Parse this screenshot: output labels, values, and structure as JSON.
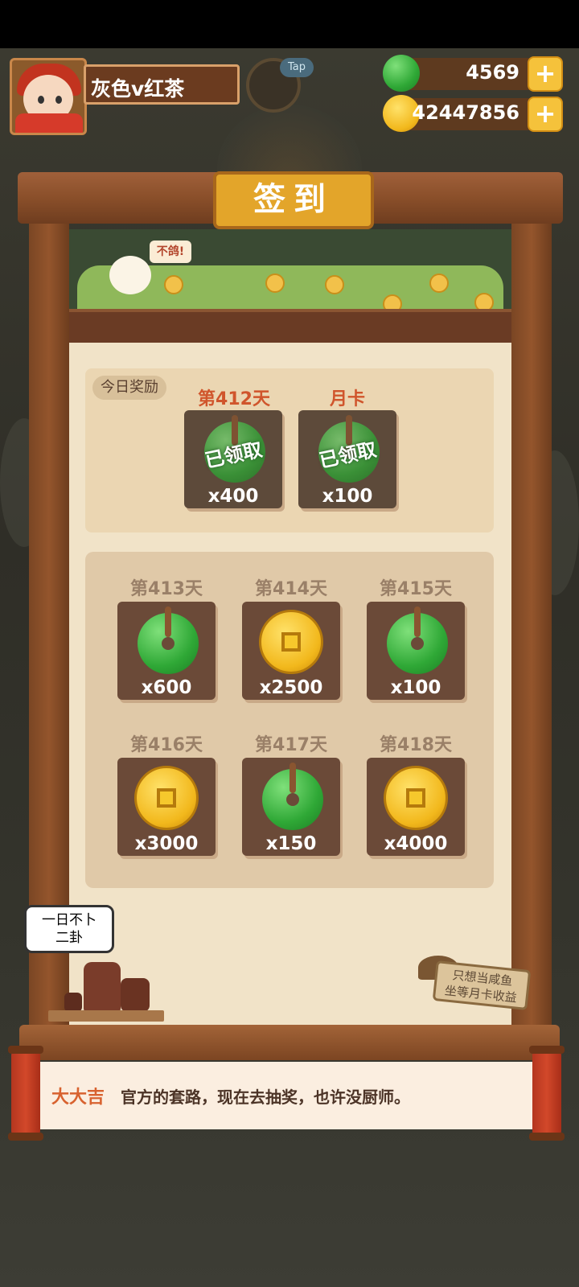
{
  "player": {
    "name": "灰色v红茶"
  },
  "tap_label": "Tap",
  "resources": {
    "jade": "4569",
    "coins": "42447856"
  },
  "title": "签到",
  "chick_bubble": "不鸽!",
  "today": {
    "tag": "今日奖励",
    "items": [
      {
        "day": "第412天",
        "type": "jade",
        "count": "x400",
        "status": "已领取"
      },
      {
        "day": "月卡",
        "type": "jade",
        "count": "x100",
        "status": "已领取"
      }
    ]
  },
  "upcoming": [
    {
      "day": "第413天",
      "type": "jade",
      "count": "x600"
    },
    {
      "day": "第414天",
      "type": "coin",
      "count": "x2500"
    },
    {
      "day": "第415天",
      "type": "jade",
      "count": "x100"
    },
    {
      "day": "第416天",
      "type": "coin",
      "count": "x3000"
    },
    {
      "day": "第417天",
      "type": "jade",
      "count": "x150"
    },
    {
      "day": "第418天",
      "type": "coin",
      "count": "x4000"
    }
  ],
  "speech": {
    "line1": "一日不卜",
    "line2": "二卦"
  },
  "sign": {
    "line1": "只想当咸鱼",
    "line2": "坐等月卡收益"
  },
  "fortune": {
    "label": "大大吉",
    "text": "官方的套路，现在去抽奖，也许没厨师。"
  },
  "colors": {
    "accent": "#e3a52a",
    "today_day": "#d0552c",
    "jade": "#2fa836",
    "coin": "#f2b81c"
  }
}
